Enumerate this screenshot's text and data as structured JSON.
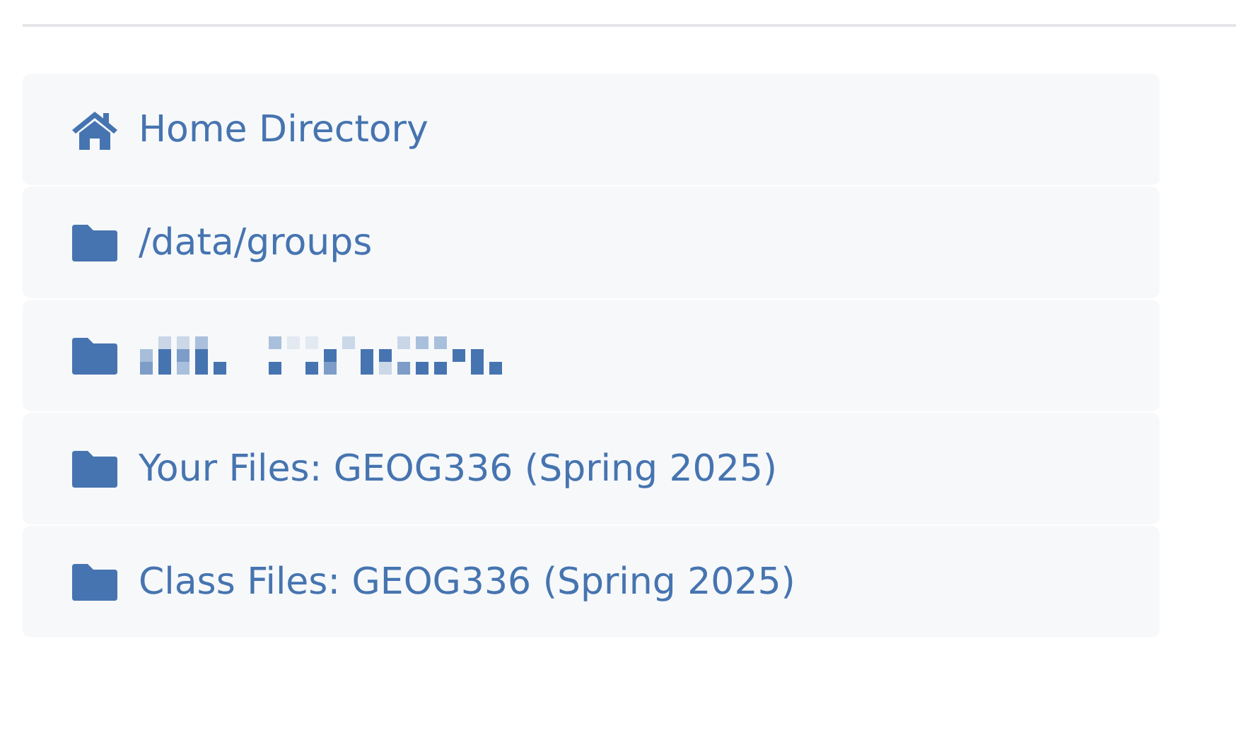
{
  "locations": [
    {
      "kind": "home",
      "label": "Home Directory"
    },
    {
      "kind": "folder",
      "label": "/data/groups"
    },
    {
      "kind": "redacted"
    },
    {
      "kind": "folder",
      "label": "Your Files: GEOG336 (Spring 2025)"
    },
    {
      "kind": "folder",
      "label": "Class Files: GEOG336 (Spring 2025)"
    }
  ]
}
